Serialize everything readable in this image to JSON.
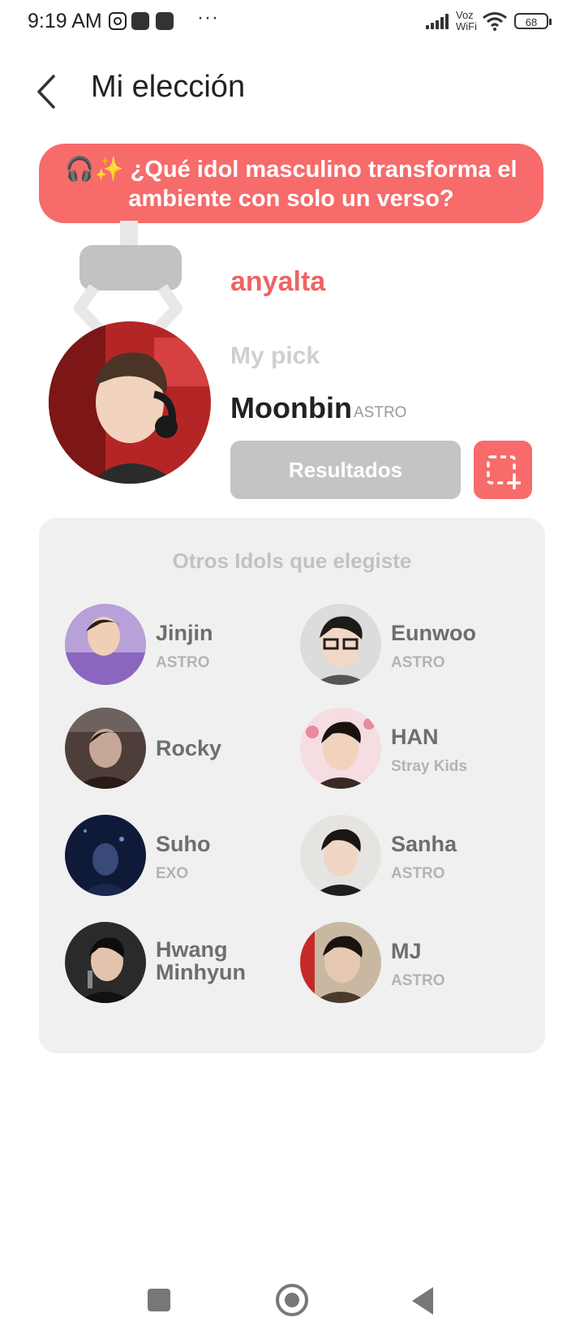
{
  "status_bar": {
    "time": "9:19 AM",
    "voz": "Voz",
    "wifi": "WiFi",
    "battery": "68"
  },
  "header": {
    "title": "Mi elección"
  },
  "question": {
    "text": "🎧✨ ¿Qué idol masculino transforma el ambiente con solo un verso?"
  },
  "user": {
    "name": "anyalta"
  },
  "pick": {
    "label": "My pick",
    "name": "Moonbin",
    "group": "ASTRO",
    "results_button": "Resultados"
  },
  "others": {
    "title": "Otros Idols que elegiste",
    "items": [
      {
        "name": "Jinjin",
        "group": "ASTRO"
      },
      {
        "name": "Eunwoo",
        "group": "ASTRO"
      },
      {
        "name": "Rocky",
        "group": ""
      },
      {
        "name": "HAN",
        "group": "Stray Kids"
      },
      {
        "name": "Suho",
        "group": "EXO"
      },
      {
        "name": "Sanha",
        "group": "ASTRO"
      },
      {
        "name": "Hwang Minhyun",
        "group": ""
      },
      {
        "name": "MJ",
        "group": "ASTRO"
      }
    ]
  },
  "colors": {
    "accent": "#f76b6b",
    "username": "#ef6363",
    "panel_bg": "#f0f0f0",
    "button_gray": "#c4c4c4"
  }
}
